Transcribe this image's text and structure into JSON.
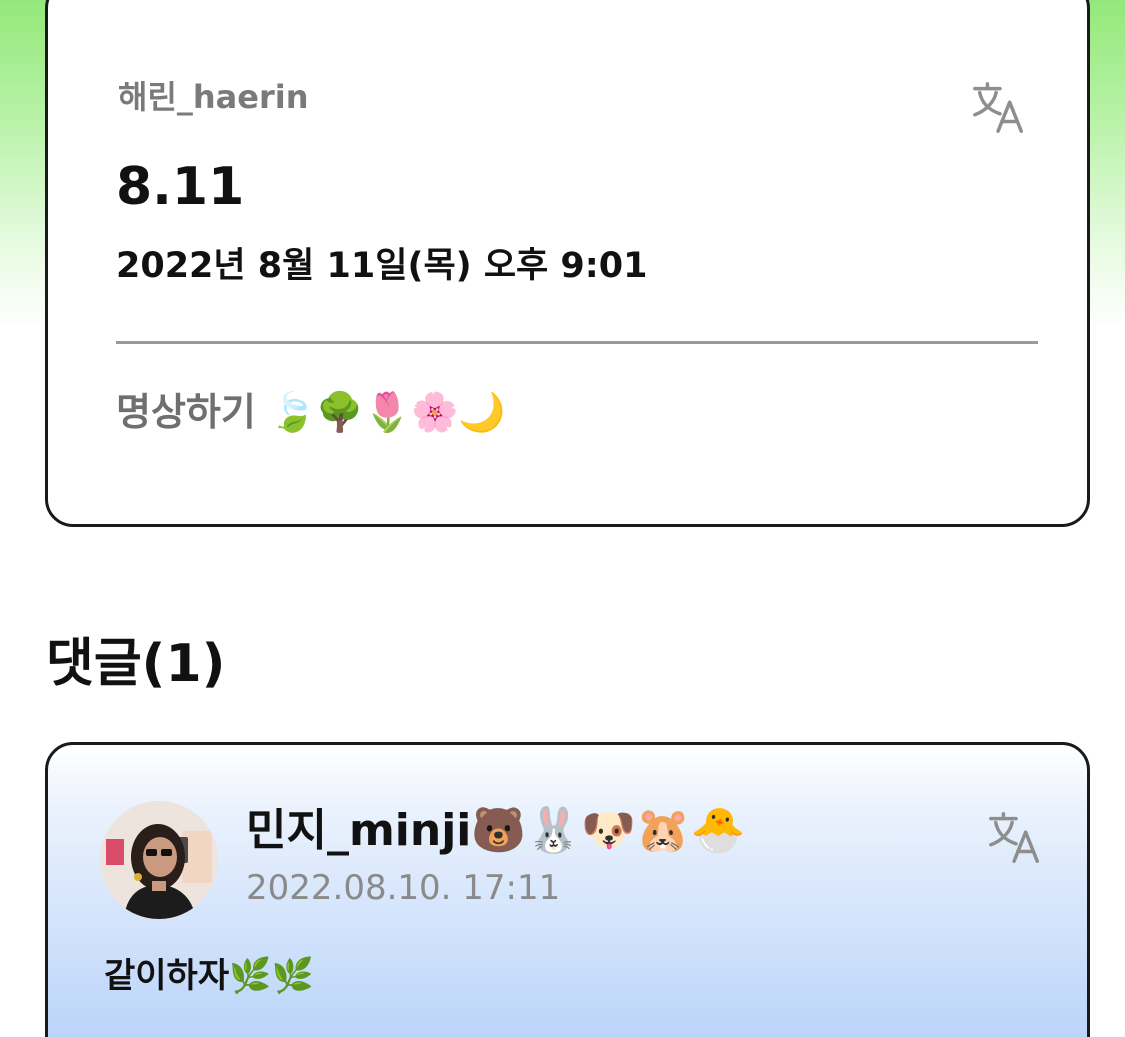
{
  "post": {
    "author": "해린_haerin",
    "title": "8.11",
    "date": "2022년 8월 11일(목) 오후 9:01",
    "body_text": "명상하기 ",
    "body_emoji": "🍃🌳🌷🌸🌙",
    "translate_icon": "translate-icon"
  },
  "comments": {
    "heading": "댓글(1)",
    "items": [
      {
        "author_name": "민지_minji",
        "author_emoji": "🐻🐰🐶🐹🐣",
        "timestamp": "2022.08.10. 17:11",
        "text": "같이하자",
        "text_emoji": "🌿🌿",
        "translate_icon": "translate-icon"
      }
    ]
  },
  "colors": {
    "top_gradient": "#93e87a",
    "comment_gradient": "#b4d0f8",
    "card_border": "#1a1a1a",
    "muted_text": "#7a7a7a"
  }
}
